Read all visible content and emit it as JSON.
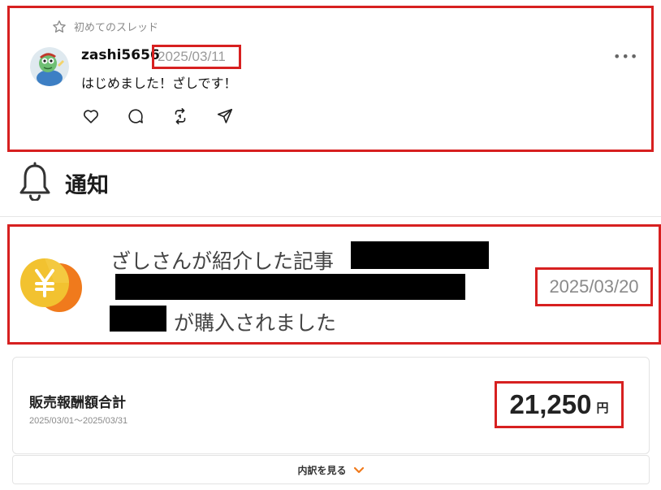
{
  "thread": {
    "title": "初めてのスレッド",
    "username": "zashi5656",
    "date": "2025/03/11",
    "text": "はじめました！ざしです！",
    "more_icon": "more-horizontal-icon",
    "actions": [
      "heart-icon",
      "comment-icon",
      "repost-icon",
      "share-icon"
    ]
  },
  "notifications": {
    "title": "通知",
    "icon": "bell-icon"
  },
  "notification_item": {
    "line1": "ざしさんが紹介した記事",
    "line3": "が購入されました",
    "date": "2025/03/20",
    "icon": "yen-coin-icon"
  },
  "sales": {
    "title": "販売報酬額合計",
    "period": "2025/03/01～2025/03/31",
    "amount": "21,250",
    "unit": "円"
  },
  "breakdown": {
    "label": "内訳を見る",
    "icon": "chevron-down-icon"
  },
  "colors": {
    "highlight_red": "#d72020",
    "accent_orange": "#f07a1c",
    "coin_yellow": "#f2c230"
  }
}
